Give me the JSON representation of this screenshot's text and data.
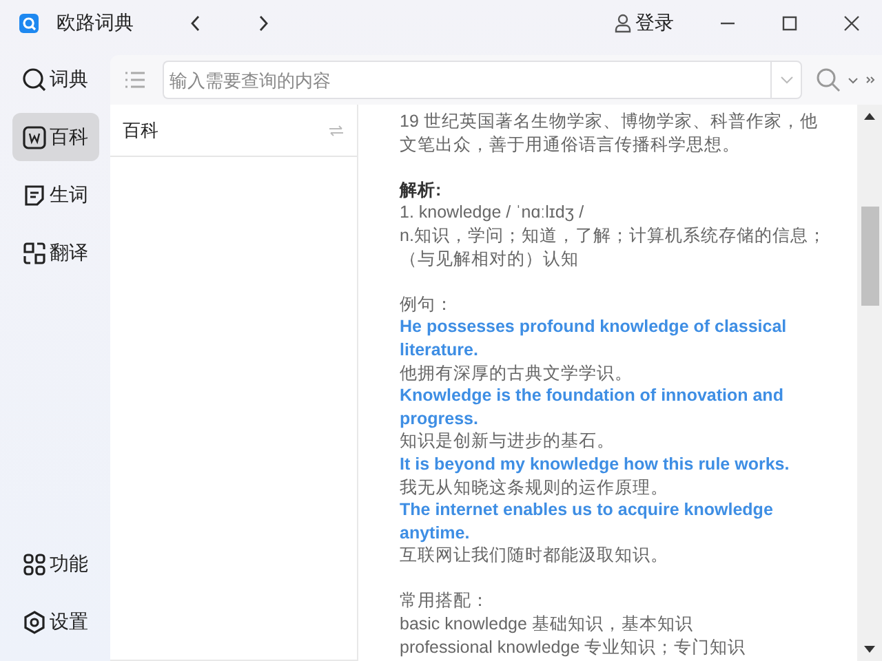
{
  "window": {
    "title": "欧路词典",
    "login": "登录"
  },
  "nav": {
    "items": [
      {
        "label": "词典",
        "selected": false
      },
      {
        "label": "百科",
        "selected": true
      },
      {
        "label": "生词",
        "selected": false
      },
      {
        "label": "翻译",
        "selected": false
      }
    ],
    "bottom": [
      {
        "label": "功能"
      },
      {
        "label": "设置"
      }
    ]
  },
  "search": {
    "placeholder": "输入需要查询的内容"
  },
  "panel": {
    "title": "百科"
  },
  "content": [
    {
      "kind": "text",
      "text": "19 世纪英国著名生物学家、博物学家、科普作家，他文笔出众，善于用通俗语言传播科学思想。"
    },
    {
      "kind": "gap"
    },
    {
      "kind": "heading",
      "text": "解析:"
    },
    {
      "kind": "text",
      "text": "1. knowledge / ˈnɑːlɪdʒ /"
    },
    {
      "kind": "text",
      "text": "n.知识，学问；知道，了解；计算机系统存储的信息；（与见解相对的）认知"
    },
    {
      "kind": "gap"
    },
    {
      "kind": "text",
      "text": "例句："
    },
    {
      "kind": "example",
      "text": "He possesses profound knowledge of classical literature."
    },
    {
      "kind": "text",
      "text": "他拥有深厚的古典文学学识。"
    },
    {
      "kind": "example",
      "text": "Knowledge is the foundation of innovation and progress."
    },
    {
      "kind": "text",
      "text": "知识是创新与进步的基石。"
    },
    {
      "kind": "example",
      "text": "It is beyond my knowledge how this rule works."
    },
    {
      "kind": "text",
      "text": "我无从知晓这条规则的运作原理。"
    },
    {
      "kind": "example",
      "text": "The internet enables us to acquire knowledge anytime."
    },
    {
      "kind": "text",
      "text": "互联网让我们随时都能汲取知识。"
    },
    {
      "kind": "gap"
    },
    {
      "kind": "text",
      "text": "常用搭配："
    },
    {
      "kind": "text",
      "text": "basic knowledge 基础知识，基本知识"
    },
    {
      "kind": "text",
      "text": "professional knowledge 专业知识；专门知识"
    }
  ]
}
